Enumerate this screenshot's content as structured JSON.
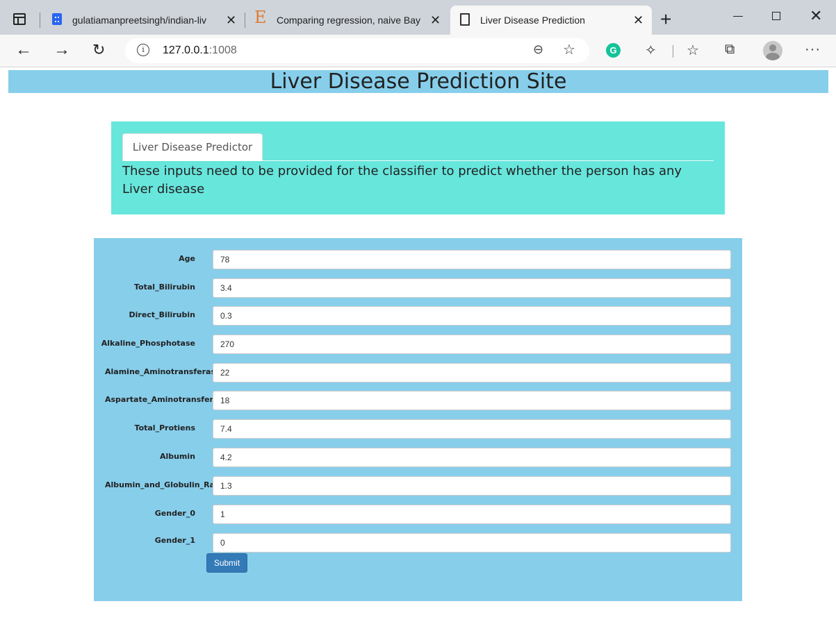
{
  "browser": {
    "tabs": [
      {
        "title": "gulatiamanpreetsingh/indian-liv",
        "favicon": "github-icon"
      },
      {
        "title": "Comparing regression, naive Bay",
        "favicon": "e-icon"
      },
      {
        "title": "Liver Disease Prediction",
        "favicon": "page-icon",
        "active": true
      }
    ],
    "close_glyph": "✕",
    "address": {
      "host": "127.0.0.1",
      "port": ":1008"
    }
  },
  "site": {
    "title": "Liver Disease Prediction Site",
    "header_color": "#87ceeb"
  },
  "info": {
    "tab_label": "Liver Disease Predictor",
    "description": "These inputs need to be provided for the classifier to predict whether the person has any Liver disease",
    "panel_color": "#67e6dc"
  },
  "form": {
    "fields": [
      {
        "label": "Age",
        "value": "78"
      },
      {
        "label": "Total_Bilirubin",
        "value": "3.4"
      },
      {
        "label": "Direct_Bilirubin",
        "value": "0.3"
      },
      {
        "label": "Alkaline_Phosphotase",
        "value": "270"
      },
      {
        "label": "Alamine_Aminotransferase",
        "value": "22"
      },
      {
        "label": "Aspartate_Aminotransferase",
        "value": "18"
      },
      {
        "label": "Total_Protiens",
        "value": "7.4"
      },
      {
        "label": "Albumin",
        "value": "4.2"
      },
      {
        "label": "Albumin_and_Globulin_Ratio",
        "value": "1.3"
      },
      {
        "label": "Gender_0",
        "value": "1"
      },
      {
        "label": "Gender_1",
        "value": "0"
      }
    ],
    "submit_label": "Submit",
    "panel_color": "#87ceeb",
    "submit_color": "#337ab7"
  }
}
